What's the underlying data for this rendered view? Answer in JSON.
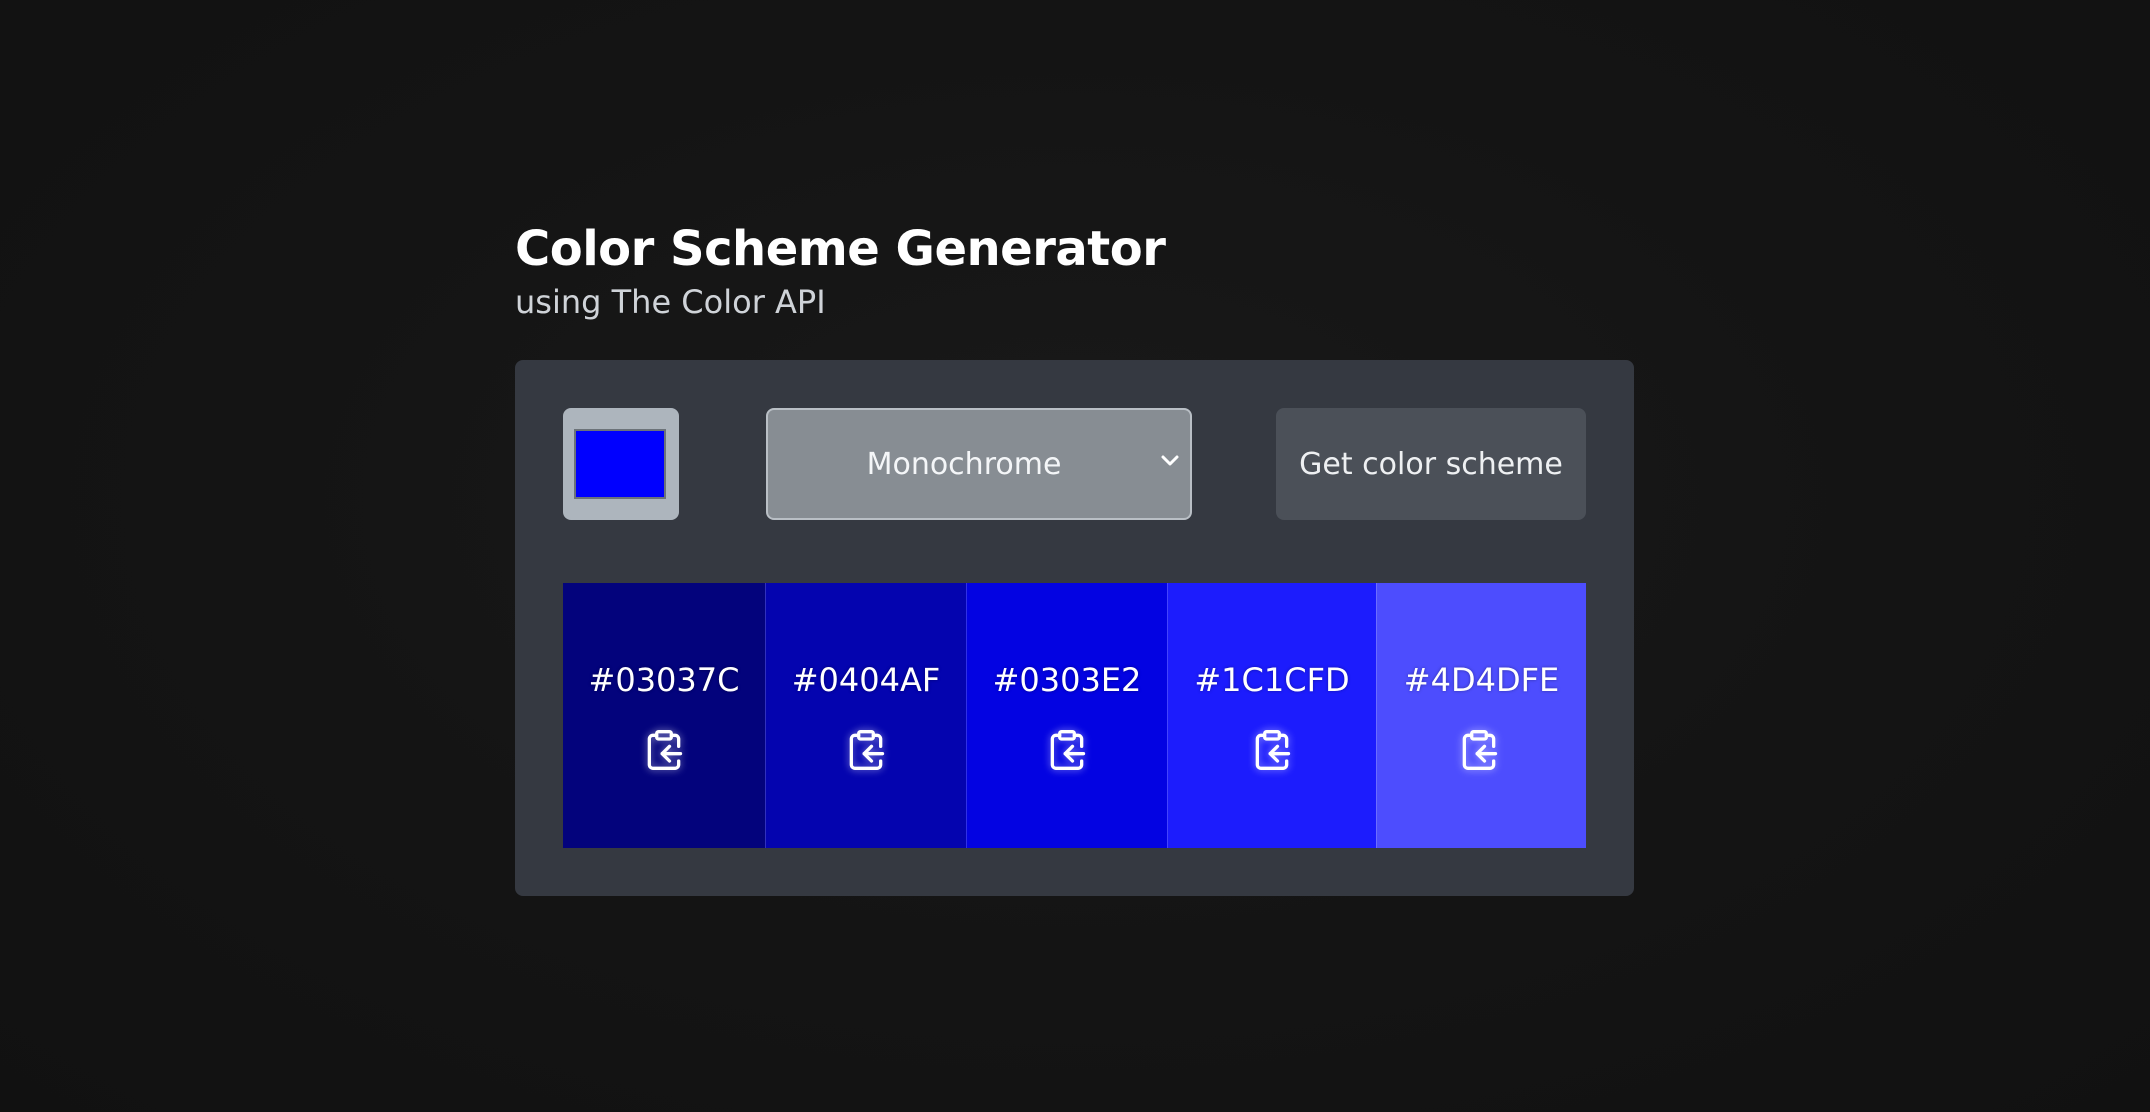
{
  "header": {
    "title": "Color Scheme Generator",
    "subtitle": "using The Color API"
  },
  "controls": {
    "seed_color": "#0000FF",
    "mode_selected": "Monochrome",
    "get_button_label": "Get color scheme",
    "chevron_icon": "chevron-down-icon"
  },
  "palette": {
    "swatches": [
      {
        "hex": "#03037C",
        "color": "#03037C",
        "icon": "clipboard-copy-icon"
      },
      {
        "hex": "#0404AF",
        "color": "#0404AF",
        "icon": "clipboard-copy-icon"
      },
      {
        "hex": "#0303E2",
        "color": "#0303E2",
        "icon": "clipboard-copy-icon"
      },
      {
        "hex": "#1C1CFD",
        "color": "#1C1CFD",
        "icon": "clipboard-copy-icon"
      },
      {
        "hex": "#4D4DFE",
        "color": "#4D4DFE",
        "icon": "clipboard-copy-icon"
      }
    ]
  },
  "colors": {
    "page_bg": "#141414",
    "panel_bg": "#353941",
    "select_bg": "#878D93",
    "button_bg": "#4B5058",
    "picker_frame": "#ADB5BD"
  }
}
